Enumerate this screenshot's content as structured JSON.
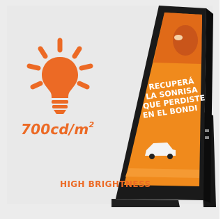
{
  "brightness": {
    "value": "700cd/m",
    "unit_superscript": "2"
  },
  "feature_label": "HIGH BRIGHTNESS",
  "screen_ad": {
    "headline_lines": [
      "RECUPERÁ",
      "LA SONRISA",
      "QUE PERDISTE",
      "EN EL BONDI"
    ]
  },
  "colors": {
    "accent": "#ec6a25",
    "screen_orange": "#f08a1c",
    "frame": "#1a1a1a",
    "background": "#ececec"
  },
  "icons": [
    "lightbulb-icon",
    "car-icon"
  ]
}
